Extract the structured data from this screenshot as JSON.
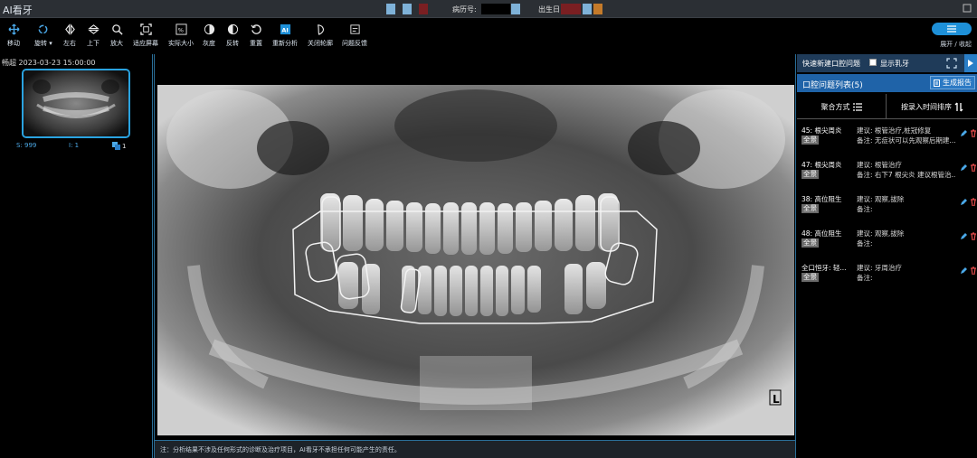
{
  "app": {
    "title": "AI看牙"
  },
  "header": {
    "record_label": "病历号:",
    "dob_label": "出生日"
  },
  "colors": {
    "accent": "#1e90d8",
    "header_panel": "#1f63a8",
    "thumb_border": "#2aa3e0"
  },
  "toolbar": {
    "tools": [
      {
        "label": "移动",
        "icon": "move-icon"
      },
      {
        "label": "旋转 ▾",
        "icon": "rotate-icon"
      },
      {
        "label": "左右",
        "icon": "flip-horizontal-icon"
      },
      {
        "label": "上下",
        "icon": "flip-vertical-icon"
      },
      {
        "label": "放大",
        "icon": "zoom-icon"
      },
      {
        "label": "适应屏幕",
        "icon": "fit-screen-icon"
      },
      {
        "label": "实际大小",
        "icon": "actual-size-icon"
      },
      {
        "label": "灰度",
        "icon": "grayscale-icon"
      },
      {
        "label": "反转",
        "icon": "invert-icon"
      },
      {
        "label": "重置",
        "icon": "reset-icon"
      },
      {
        "label": "重新分析",
        "icon": "ai-reanalyze-icon"
      },
      {
        "label": "关闭轮廓",
        "icon": "outline-icon"
      },
      {
        "label": "问题反馈",
        "icon": "feedback-icon"
      }
    ],
    "expand_label": "展开 / 收起"
  },
  "left": {
    "study": "畅超 2023-03-23 15:00:00",
    "stats": {
      "s": "S: 999",
      "i": "I: 1",
      "count": "1"
    }
  },
  "viewer": {
    "marker": "L",
    "disclaimer": "注：分析结果不涉及任何形式的诊断及治疗项目，AI看牙不承担任何可能产生的责任。"
  },
  "right": {
    "quick_new": "快速新建口腔问题",
    "show_canal": "显示乳牙",
    "list_title": "口腔问题列表(5)",
    "generate_report": "生成报告",
    "merge_label": "聚合方式",
    "sort_label": "按录入时间排序",
    "problems": [
      {
        "tooth": "45: 根尖周炎",
        "tag": "全景",
        "suggestion": "建议: 根管治疗,桩冠修复",
        "note": "备注: 无症状可以先观察后期建..."
      },
      {
        "tooth": "47: 根尖周炎",
        "tag": "全景",
        "suggestion": "建议: 根管治疗",
        "note": "备注: 右下7 根尖炎 建议根管治..."
      },
      {
        "tooth": "38: 高位阻生",
        "tag": "全景",
        "suggestion": "建议: 观察,拔除",
        "note": "备注:"
      },
      {
        "tooth": "48: 高位阻生",
        "tag": "全景",
        "suggestion": "建议: 观察,拔除",
        "note": "备注:"
      },
      {
        "tooth": "全口恒牙: 轻...",
        "tag": "全景",
        "suggestion": "建议: 牙周治疗",
        "note": "备注:"
      }
    ]
  }
}
